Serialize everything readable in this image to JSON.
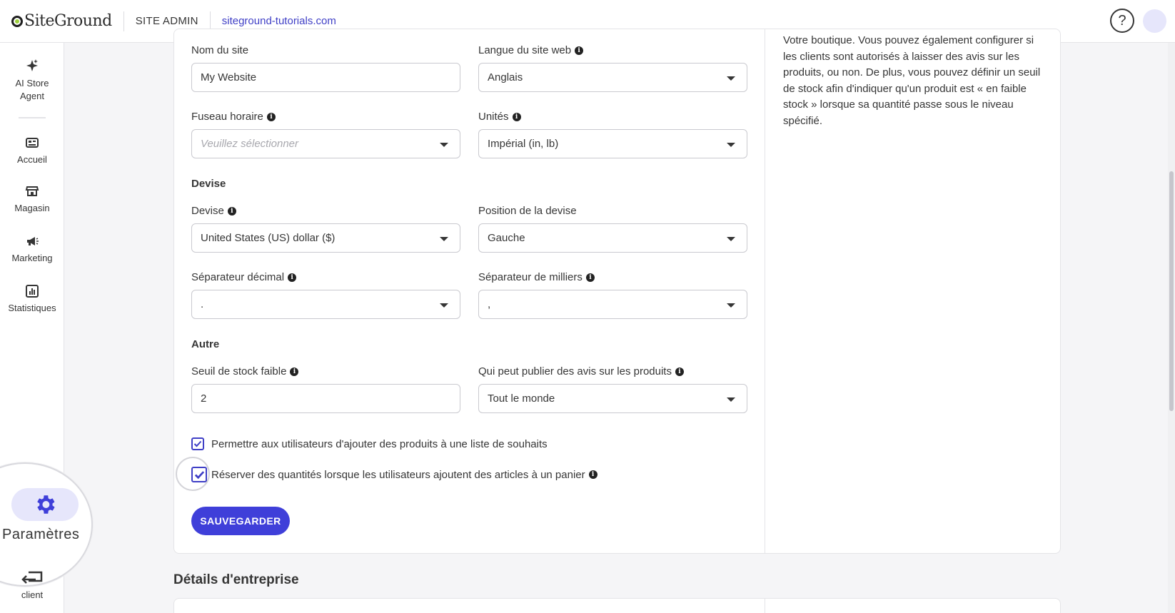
{
  "header": {
    "logo_text": "SiteGround",
    "section": "SITE ADMIN",
    "site_url": "siteground-tutorials.com",
    "help_label": "?"
  },
  "sidebar": {
    "items": [
      {
        "label": "AI Store Agent",
        "icon": "sparkle-icon"
      },
      {
        "label": "Accueil",
        "icon": "dashboard-icon"
      },
      {
        "label": "Magasin",
        "icon": "store-icon"
      },
      {
        "label": "Marketing",
        "icon": "megaphone-icon"
      },
      {
        "label": "Statistiques",
        "icon": "chart-icon"
      }
    ],
    "settings_label": "Paramètres",
    "client_label": "client"
  },
  "side_description": "Votre boutique. Vous pouvez également configurer si les clients sont autorisés à laisser des avis sur les produits, ou non. De plus, vous pouvez définir un seuil de stock afin d'indiquer qu'un produit est « en faible stock » lorsque sa quantité passe sous le niveau spécifié.",
  "form": {
    "site_name": {
      "label": "Nom du site",
      "value": "My Website"
    },
    "site_language": {
      "label": "Langue du site web",
      "value": "Anglais"
    },
    "timezone": {
      "label": "Fuseau horaire",
      "placeholder": "Veuillez sélectionner"
    },
    "units": {
      "label": "Unités",
      "value": "Impérial (in, lb)"
    },
    "currency_section": "Devise",
    "currency": {
      "label": "Devise",
      "value": "United States (US) dollar ($)"
    },
    "currency_position": {
      "label": "Position de la devise",
      "value": "Gauche"
    },
    "decimal_separator": {
      "label": "Séparateur décimal",
      "value": "."
    },
    "thousands_separator": {
      "label": "Séparateur de milliers",
      "value": ","
    },
    "other_section": "Autre",
    "low_stock": {
      "label": "Seuil de stock faible",
      "value": "2"
    },
    "reviews": {
      "label": "Qui peut publier des avis sur les produits",
      "value": "Tout le monde"
    },
    "wishlist": {
      "label": "Permettre aux utilisateurs d'ajouter des produits à une liste de souhaits",
      "checked": true
    },
    "reserve": {
      "label": "Réserver des quantités lorsque les utilisateurs ajoutent des articles à un panier",
      "checked": true
    },
    "save_label": "SAUVEGARDER"
  },
  "business_section_title": "Détails d'entreprise",
  "colors": {
    "accent": "#3f3fd9",
    "accent_light": "#e6e6fb",
    "logo_green": "#9ccf3a"
  }
}
